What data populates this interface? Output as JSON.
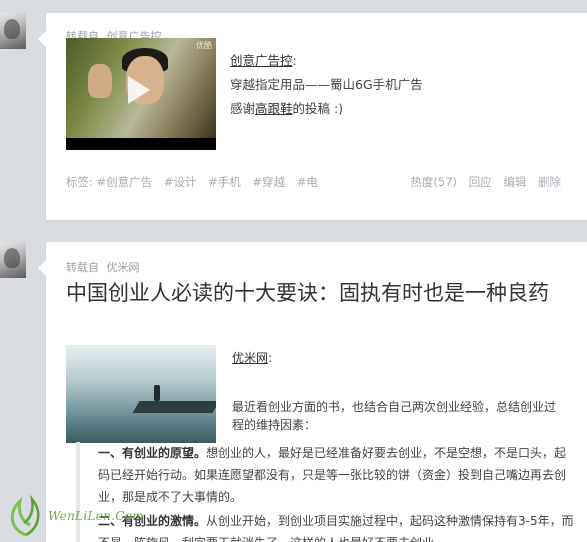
{
  "post1": {
    "reblog_label": "转载自",
    "source": "创意广告控",
    "video": {
      "brand": "优酷"
    },
    "source_link": "创意广告控",
    "line1": "穿越指定用品——蜀山6G手机广告",
    "line2_prefix": "感谢",
    "line2_link": "高跟鞋",
    "line2_suffix": "的投稿 :)",
    "tags_label": "标签:",
    "tags": [
      "#创意广告",
      "#设计",
      "#手机",
      "#穿越",
      "#电"
    ],
    "heat": "热度(57)",
    "reply": "回应",
    "edit": "编辑",
    "delete": "删除"
  },
  "post2": {
    "reblog_label": "转载自",
    "source": "优米网",
    "title": "中国创业人必读的十大要诀：固执有时也是一种良药",
    "source_link": "优米网",
    "intro": "最近看创业方面的书，也结合自己两次创业经验，总结创业过程的维持因素：",
    "items": [
      {
        "lead": "一、有创业的原望。",
        "text": "想创业的人，最好是已经准备好要去创业，不是空想，不是口头，起码已经开始行动。如果连愿望都没有，只是等一张比较的饼（资金）投到自己嘴边再去创业，那是成不了大事情的。"
      },
      {
        "lead": "二、有创业的激情。",
        "text": "从创业开始，到创业项目实施过程中，起码这种激情保持有3-5年，而不是一阵旋风，刮完要干就消失了，这样的人也最好不要去创业。"
      }
    ]
  },
  "watermark": {
    "text": "WenLiLen.Com"
  }
}
